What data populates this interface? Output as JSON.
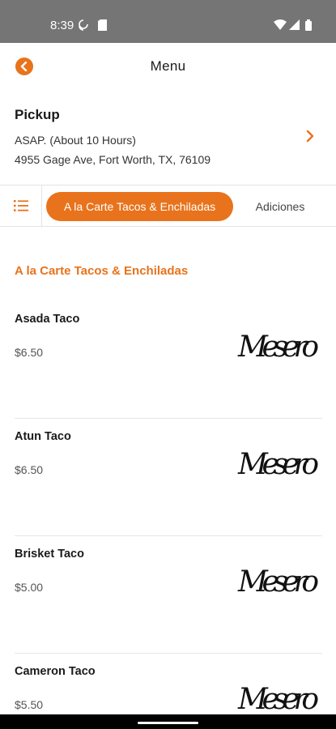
{
  "status_bar": {
    "time": "8:39",
    "icons": [
      "sync-icon",
      "sim-card-icon",
      "wifi-icon",
      "signal-icon",
      "battery-icon"
    ]
  },
  "app_bar": {
    "title": "Menu",
    "back_icon": "chevron-left-icon",
    "accent_color": "#e8731c"
  },
  "pickup": {
    "heading": "Pickup",
    "time_text": "ASAP. (About 10 Hours)",
    "address": "4955 Gage Ave, Fort Worth, TX, 76109"
  },
  "categories": {
    "menu_icon": "list-icon",
    "active": "A la Carte Tacos & Enchiladas",
    "other": "Adiciones"
  },
  "section": {
    "title": "A la Carte Tacos & Enchiladas"
  },
  "items": [
    {
      "name": "Asada Taco",
      "price": "$6.50",
      "image_text": "Mesero"
    },
    {
      "name": "Atun Taco",
      "price": "$6.50",
      "image_text": "Mesero"
    },
    {
      "name": "Brisket Taco",
      "price": "$5.00",
      "image_text": "Mesero"
    },
    {
      "name": "Cameron Taco",
      "price": "$5.50",
      "image_text": "Mesero"
    }
  ]
}
